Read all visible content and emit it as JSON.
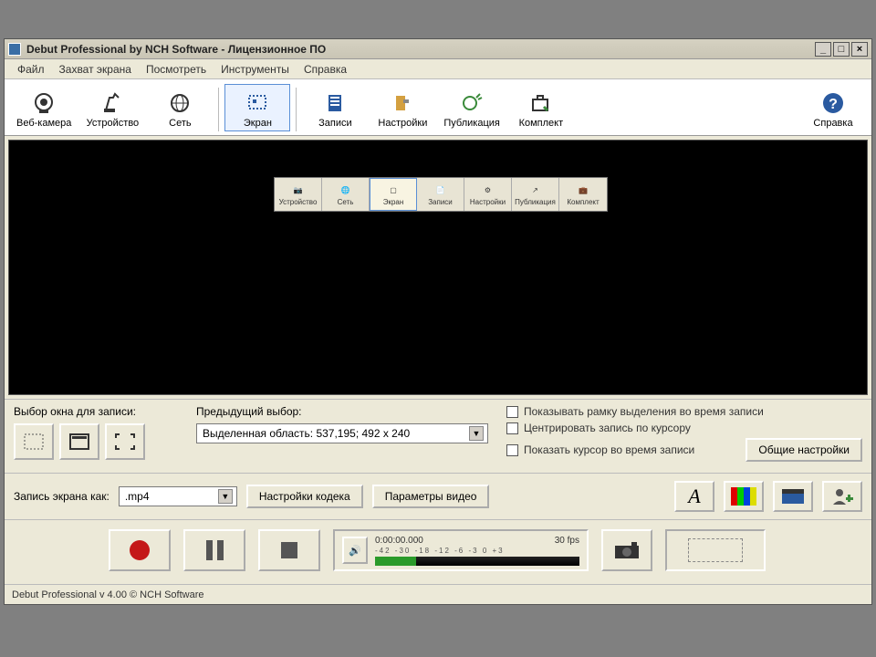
{
  "title": "Debut Professional by NCH Software - Лицензионное ПО",
  "menubar": [
    "Файл",
    "Захват экрана",
    "Посмотреть",
    "Инструменты",
    "Справка"
  ],
  "toolbar": {
    "items": [
      {
        "label": "Веб-камера"
      },
      {
        "label": "Устройство"
      },
      {
        "label": "Сеть"
      },
      {
        "label": "Экран"
      },
      {
        "label": "Записи"
      },
      {
        "label": "Настройки"
      },
      {
        "label": "Публикация"
      },
      {
        "label": "Комплект"
      }
    ],
    "help": "Справка"
  },
  "mini": [
    "Устройство",
    "Сеть",
    "Экран",
    "Записи",
    "Настройки",
    "Публикация",
    "Комплект"
  ],
  "selection": {
    "window_label": "Выбор окна для записи:",
    "prev_label": "Предыдущий выбор:",
    "prev_value": "Выделенная область: 537,195; 492 x 240"
  },
  "checks": {
    "c1": "Показывать рамку выделения во время записи",
    "c2": "Центрировать запись по курсору",
    "c3": "Показать курсор во время записи",
    "general": "Общие настройки"
  },
  "format": {
    "label": "Запись экрана как:",
    "value": ".mp4",
    "codec_btn": "Настройки кодека",
    "video_btn": "Параметры видео"
  },
  "meter": {
    "time": "0:00:00.000",
    "fps": "30 fps",
    "ticks": "-42 -30 -18 -12 -6 -3  0  +3"
  },
  "status": "Debut Professional v 4.00 © NCH Software"
}
